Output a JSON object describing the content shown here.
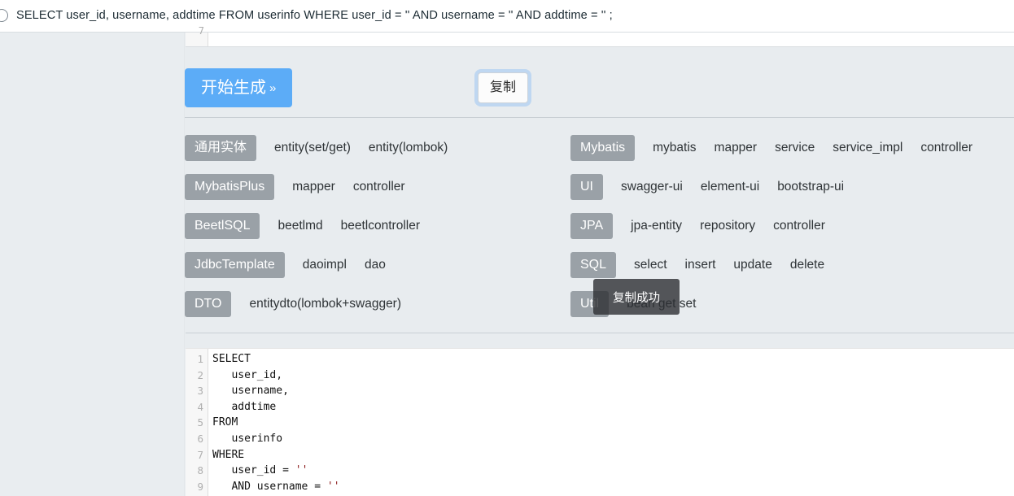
{
  "topbar": {
    "icon": "circle-icon",
    "sql_text": "SELECT user_id, username, addtime FROM userinfo WHERE user_id = '' AND username = '' AND addtime = '' ;"
  },
  "editor_tail": {
    "line_number": "7"
  },
  "actions": {
    "generate_label": "开始生成",
    "generate_chevron": "»",
    "copy_label": "复制"
  },
  "toast": {
    "message": "复制成功"
  },
  "groups": {
    "left": [
      {
        "badge": "通用实体",
        "items": [
          "entity(set/get)",
          "entity(lombok)"
        ]
      },
      {
        "badge": "MybatisPlus",
        "items": [
          "mapper",
          "controller"
        ]
      },
      {
        "badge": "BeetlSQL",
        "items": [
          "beetlmd",
          "beetlcontroller"
        ]
      },
      {
        "badge": "JdbcTemplate",
        "items": [
          "daoimpl",
          "dao"
        ]
      },
      {
        "badge": "DTO",
        "items": [
          "entitydto(lombok+swagger)"
        ]
      }
    ],
    "right": [
      {
        "badge": "Mybatis",
        "items": [
          "mybatis",
          "mapper",
          "service",
          "service_impl",
          "controller"
        ]
      },
      {
        "badge": "UI",
        "items": [
          "swagger-ui",
          "element-ui",
          "bootstrap-ui"
        ]
      },
      {
        "badge": "JPA",
        "items": [
          "jpa-entity",
          "repository",
          "controller"
        ]
      },
      {
        "badge": "SQL",
        "items": [
          "select",
          "insert",
          "update",
          "delete"
        ]
      },
      {
        "badge": "Util",
        "items": [
          "bean get set"
        ]
      }
    ]
  },
  "code": {
    "lines": [
      {
        "n": "1",
        "indent": 0,
        "text": "SELECT",
        "quoted": ""
      },
      {
        "n": "2",
        "indent": 1,
        "text": "user_id,",
        "quoted": ""
      },
      {
        "n": "3",
        "indent": 1,
        "text": "username,",
        "quoted": ""
      },
      {
        "n": "4",
        "indent": 1,
        "text": "addtime",
        "quoted": ""
      },
      {
        "n": "5",
        "indent": 0,
        "text": "FROM",
        "quoted": ""
      },
      {
        "n": "6",
        "indent": 1,
        "text": "userinfo",
        "quoted": ""
      },
      {
        "n": "7",
        "indent": 0,
        "text": "WHERE",
        "quoted": ""
      },
      {
        "n": "8",
        "indent": 1,
        "text": "user_id = ",
        "quoted": "''"
      },
      {
        "n": "9",
        "indent": 1,
        "text": "AND username = ",
        "quoted": "''"
      }
    ]
  },
  "colors": {
    "accent_blue": "#5cacf7",
    "badge_gray": "#9aa1a7",
    "page_bg": "#e8ecef",
    "toast_bg": "rgba(45,48,51,0.80)",
    "string_red": "#8b1a1a"
  }
}
